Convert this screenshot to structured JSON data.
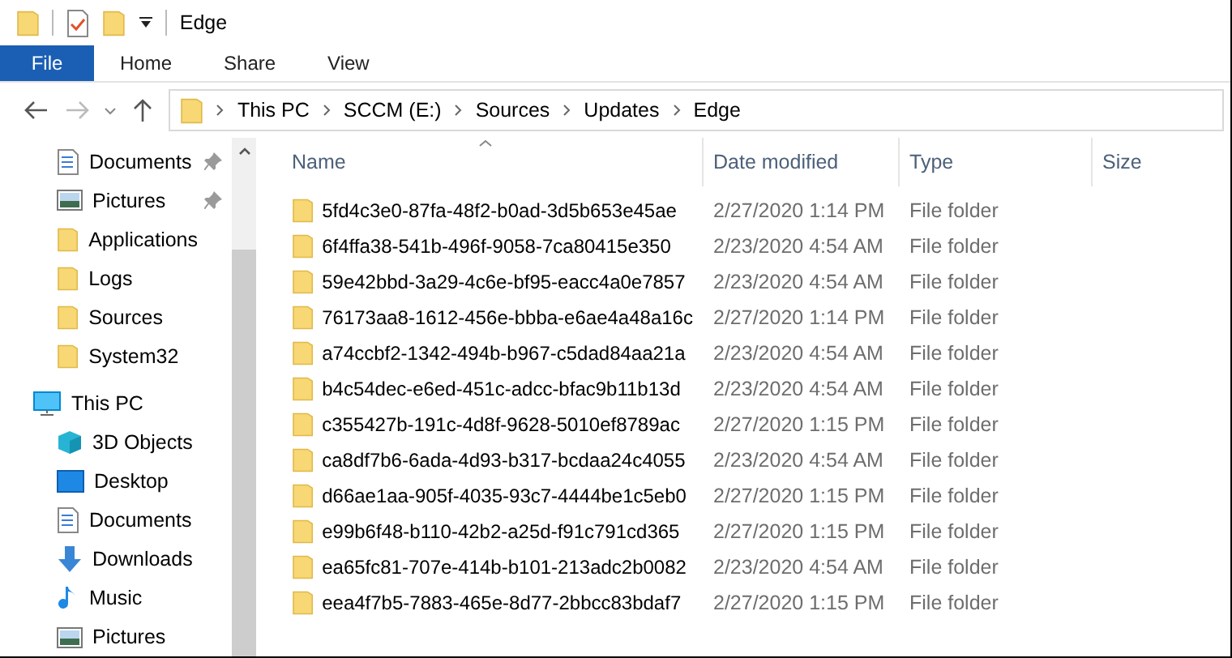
{
  "window": {
    "title": "Edge"
  },
  "ribbon_tabs": [
    {
      "label": "File",
      "selected": true
    },
    {
      "label": "Home",
      "selected": false
    },
    {
      "label": "Share",
      "selected": false
    },
    {
      "label": "View",
      "selected": false
    }
  ],
  "address": {
    "segments": [
      "This PC",
      "SCCM (E:)",
      "Sources",
      "Updates",
      "Edge"
    ]
  },
  "sidebar": {
    "quick_access": [
      {
        "label": "Documents",
        "kind": "document",
        "pinned": true
      },
      {
        "label": "Pictures",
        "kind": "picture",
        "pinned": true
      },
      {
        "label": "Applications",
        "kind": "folder",
        "pinned": false
      },
      {
        "label": "Logs",
        "kind": "folder",
        "pinned": false
      },
      {
        "label": "Sources",
        "kind": "folder",
        "pinned": false
      },
      {
        "label": "System32",
        "kind": "folder",
        "pinned": false
      }
    ],
    "this_pc": {
      "label": "This PC",
      "children": [
        {
          "label": "3D Objects",
          "kind": "cube"
        },
        {
          "label": "Desktop",
          "kind": "desktop"
        },
        {
          "label": "Documents",
          "kind": "document"
        },
        {
          "label": "Downloads",
          "kind": "download"
        },
        {
          "label": "Music",
          "kind": "music"
        },
        {
          "label": "Pictures",
          "kind": "picture"
        }
      ]
    }
  },
  "table": {
    "columns": [
      "Name",
      "Date modified",
      "Type",
      "Size"
    ],
    "rows": [
      {
        "name": "5fd4c3e0-87fa-48f2-b0ad-3d5b653e45ae",
        "date": "2/27/2020 1:14 PM",
        "type": "File folder"
      },
      {
        "name": "6f4ffa38-541b-496f-9058-7ca80415e350",
        "date": "2/23/2020 4:54 AM",
        "type": "File folder"
      },
      {
        "name": "59e42bbd-3a29-4c6e-bf95-eacc4a0e7857",
        "date": "2/23/2020 4:54 AM",
        "type": "File folder"
      },
      {
        "name": "76173aa8-1612-456e-bbba-e6ae4a48a16c",
        "date": "2/27/2020 1:14 PM",
        "type": "File folder"
      },
      {
        "name": "a74ccbf2-1342-494b-b967-c5dad84aa21a",
        "date": "2/23/2020 4:54 AM",
        "type": "File folder"
      },
      {
        "name": "b4c54dec-e6ed-451c-adcc-bfac9b11b13d",
        "date": "2/23/2020 4:54 AM",
        "type": "File folder"
      },
      {
        "name": "c355427b-191c-4d8f-9628-5010ef8789ac",
        "date": "2/27/2020 1:15 PM",
        "type": "File folder"
      },
      {
        "name": "ca8df7b6-6ada-4d93-b317-bcdaa24c4055",
        "date": "2/23/2020 4:54 AM",
        "type": "File folder"
      },
      {
        "name": "d66ae1aa-905f-4035-93c7-4444be1c5eb0",
        "date": "2/27/2020 1:15 PM",
        "type": "File folder"
      },
      {
        "name": "e99b6f48-b110-42b2-a25d-f91c791cd365",
        "date": "2/27/2020 1:15 PM",
        "type": "File folder"
      },
      {
        "name": "ea65fc81-707e-414b-b101-213adc2b0082",
        "date": "2/23/2020 4:54 AM",
        "type": "File folder"
      },
      {
        "name": "eea4f7b5-7883-465e-8d77-2bbcc83bdaf7",
        "date": "2/27/2020 1:15 PM",
        "type": "File folder"
      }
    ]
  }
}
